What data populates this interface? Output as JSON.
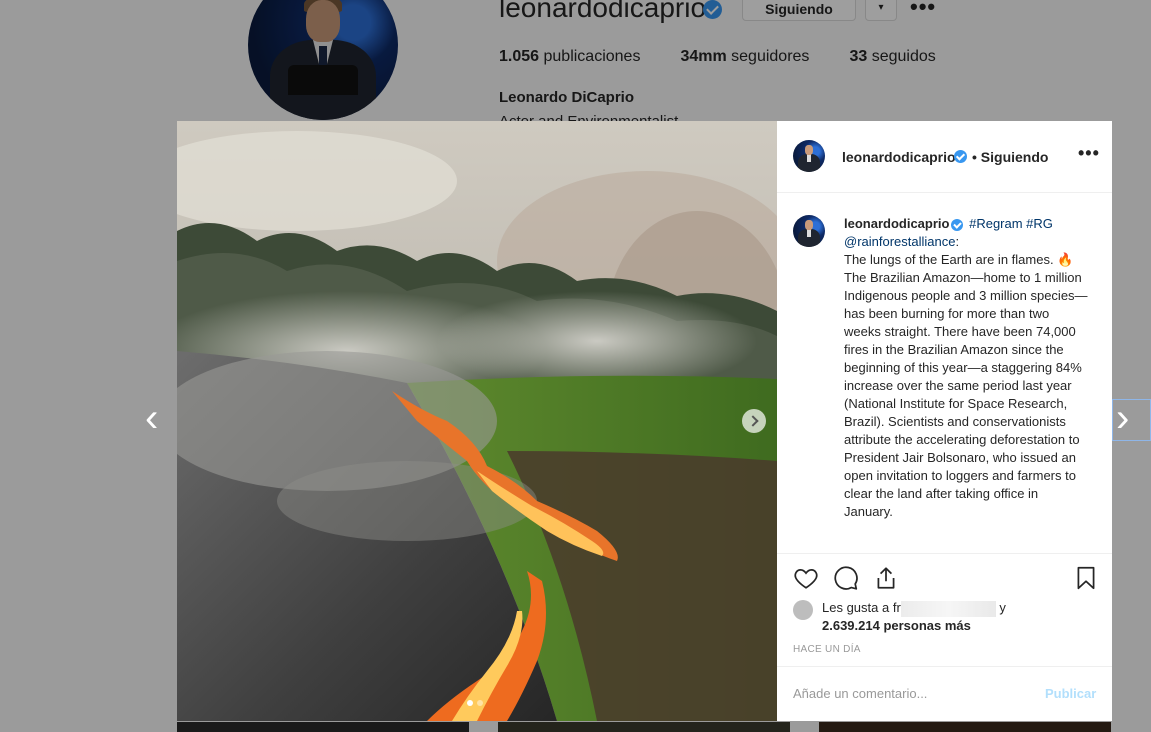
{
  "profile": {
    "username": "leonardodicaprio",
    "follow_button": "Siguiendo",
    "caret": "▾",
    "more": "•••",
    "stats": [
      {
        "value": "1.056",
        "label": "publicaciones"
      },
      {
        "value": "34mm",
        "label": "seguidores"
      },
      {
        "value": "33",
        "label": "seguidos"
      }
    ],
    "full_name": "Leonardo DiCaprio",
    "bio": "Actor and Environmentalist"
  },
  "post": {
    "header": {
      "username": "leonardodicaprio",
      "follow_status": "• Siguiendo",
      "more": "•••"
    },
    "caption": {
      "username": "leonardodicaprio",
      "tags": "#Regram #RG",
      "mention": "@rainforestalliance",
      "mention_suffix": ":",
      "text": "The lungs of the Earth are in flames. 🔥 The Brazilian Amazon—home to 1 million Indigenous people and 3 million species—has been burning for more than two weeks straight. There have been 74,000 fires in the Brazilian Amazon since the beginning of this year—a staggering 84% increase over the same period last year (National Institute for Space Research, Brazil). Scientists and conservationists attribute the accelerating deforestation to President Jair Bolsonaro, who issued an open invitation to loggers and farmers to clear the land after taking office in January."
    },
    "likes": {
      "prefix": "Les gusta a",
      "visible_fragment": "fr",
      "suffix": "y",
      "count_text": "2.639.214 personas más"
    },
    "timestamp": "HACE UN DÍA",
    "comment_placeholder": "Añade un comentario...",
    "publish_label": "Publicar",
    "carousel": {
      "total": 2,
      "active": 1
    }
  },
  "navigation": {
    "prev": "‹",
    "next": "›"
  },
  "colors": {
    "accent": "#3897f0",
    "link": "#003569",
    "publish_disabled": "#b2dffc"
  }
}
